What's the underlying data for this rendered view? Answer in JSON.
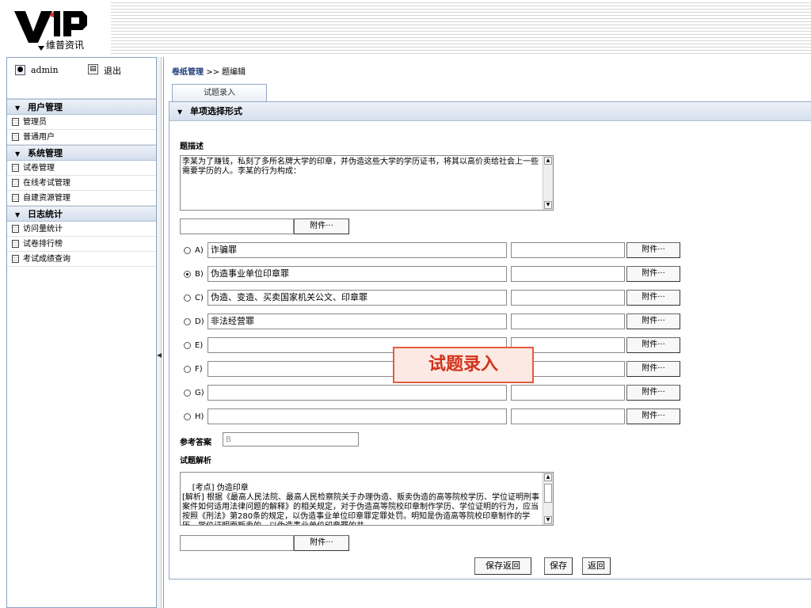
{
  "logo": {
    "text": "维普资讯"
  },
  "user": {
    "name": "admin",
    "logout": "退出"
  },
  "sidebar": {
    "groups": [
      {
        "title": "用户管理",
        "items": [
          "管理员",
          "普通用户"
        ]
      },
      {
        "title": "系统管理",
        "items": [
          "试卷管理",
          "在线考试管理",
          "自建资源管理"
        ]
      },
      {
        "title": "日志统计",
        "items": [
          "访问量统计",
          "试卷排行榜",
          "考试成绩查询"
        ]
      }
    ]
  },
  "breadcrumb": {
    "section": "卷纸管理",
    "separator": ">>",
    "page": "题编辑"
  },
  "tab": {
    "label": "试题录入"
  },
  "panel": {
    "title": "单项选择形式"
  },
  "question": {
    "desc_label": "题描述",
    "desc_text": "李某为了赚钱，私刻了多所名牌大学的印章，并伪造这些大学的学历证书，将其以高价卖给社会上一些需要学历的人。李某的行为构成：",
    "attach_label": "附件···"
  },
  "options": [
    {
      "letter": "A)",
      "text": "诈骗罪",
      "selected": false
    },
    {
      "letter": "B)",
      "text": "伪造事业单位印章罪",
      "selected": true
    },
    {
      "letter": "C)",
      "text": "伪造、变造、买卖国家机关公文、印章罪",
      "selected": false
    },
    {
      "letter": "D)",
      "text": "非法经营罪",
      "selected": false
    },
    {
      "letter": "E)",
      "text": "",
      "selected": false
    },
    {
      "letter": "F)",
      "text": "",
      "selected": false
    },
    {
      "letter": "G)",
      "text": "",
      "selected": false
    },
    {
      "letter": "H)",
      "text": "",
      "selected": false
    }
  ],
  "answer": {
    "label": "参考答案",
    "value": "B"
  },
  "analysis": {
    "label": "试题解析",
    "text": "[考点] 伪造印章\n[解析] 根据《最高人民法院、最高人民检察院关于办理伪造、贩卖伪造的高等院校学历、学位证明刑事案件如何适用法律问题的解释》的相关规定，对于伪造高等院校印章制作学历、学位证明的行为，应当按照《刑法》第280条的规定，以伪造事业单位印章罪定罪处罚。明知是伪造高等院校印章制作的学历、学位证明而贩卖的，以伪造事业单位印章罪的共"
  },
  "buttons": {
    "save_return": "保存返回",
    "save": "保存",
    "back": "返回"
  },
  "callout": {
    "text": "试题录入"
  }
}
